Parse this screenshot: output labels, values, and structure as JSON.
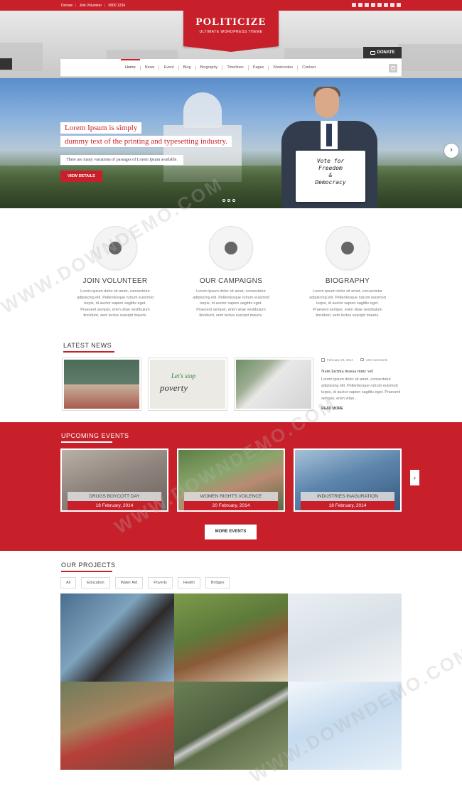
{
  "topbar": {
    "donate": "Donate",
    "join": "Join Volunteer",
    "phone": "0800 1234",
    "social_icons": [
      "facebook-icon",
      "linkedin-icon",
      "google-plus-icon",
      "instagram-icon",
      "twitter-icon",
      "pinterest-icon",
      "rss-icon",
      "flickr-icon"
    ]
  },
  "logo": {
    "title": "POLITICIZE",
    "subtitle": "ULTIMATE WORDPRESS THEME"
  },
  "donate_button": "DONATE",
  "nav": {
    "items": [
      "Home",
      "News",
      "Event",
      "Blog",
      "Biography",
      "Timelines",
      "Pages",
      "Shortcodes",
      "Contact"
    ]
  },
  "hero": {
    "headline1": "Lorem Ipsum is simply",
    "headline2": "dummy text of the printing and typesetting industry.",
    "sub": "There are many variations of passages of Lorem Ipsum available.",
    "button": "VIEW DETAILS",
    "sign": [
      "Vote for",
      "Freedom",
      "&",
      "Democracy"
    ]
  },
  "features": [
    {
      "title": "JOIN VOLUNTEER",
      "text": "Lorem ipsum dolor sit amet, consectetur adipiscing elit. Pellentesque rutrum euismod turpis, id auctor sapien sagittis eget. Praesent semper, enim vitae vestibulum tincidunt, sem lectus suscipit mauris."
    },
    {
      "title": "OUR CAMPAIGNS",
      "text": "Lorem ipsum dolor sit amet, consectetur adipiscing elit. Pellentesque rutrum euismod turpis, id auctor sapien sagittis eget. Praesent semper, enim vitae vestibulum tincidunt, sem lectus suscipit mauris."
    },
    {
      "title": "BIOGRAPHY",
      "text": "Lorem ipsum dolor sit amet, consectetur adipiscing elit. Pellentesque rutrum euismod turpis, id auctor sapien sagittis eget. Praesent semper, enim vitae vestibulum tincidunt, sem lectus suscipit mauris."
    }
  ],
  "news": {
    "title": "LATEST NEWS",
    "date": "February 20, 2014",
    "comments": "136 Comments",
    "post_title": "Nam lacinia massa nunc vel",
    "post_text": "Lorem ipsum dolor sit amet, consectetur adipiscing elit. Pellentesque rutrum euismod turpis, id auctor sapien sagittis eget. Praesent semper, enim vitae...",
    "read_more": "READ MORE",
    "poster_text": [
      "Let's stop",
      "poverty"
    ]
  },
  "events": {
    "title": "UPCOMING EVENTS",
    "items": [
      {
        "name": "DRUGS BOYCOTT DAY",
        "date": "18 February, 2014"
      },
      {
        "name": "WOMEN RIGHTS VOILENCE",
        "date": "20 February, 2014"
      },
      {
        "name": "INDUSTRIES INAGURATION",
        "date": "18 February, 2014"
      }
    ],
    "more": "MORE EVENTS"
  },
  "projects": {
    "title": "OUR PROJECTS",
    "filters": [
      "All",
      "Education",
      "Water Aid",
      "Poverty",
      "Health",
      "Bridges"
    ]
  },
  "watermark": "WWW.DOWNDEMO.COM"
}
